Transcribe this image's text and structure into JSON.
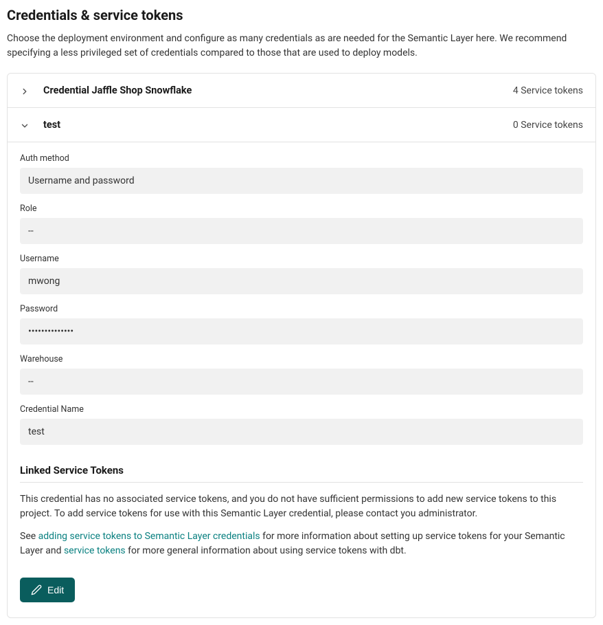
{
  "header": {
    "title": "Credentials & service tokens",
    "description": "Choose the deployment environment and configure as many credentials as are needed for the Semantic Layer here. We recommend specifying a less privileged set of credentials compared to those that are used to deploy models."
  },
  "credentials": [
    {
      "name": "Credential Jaffle Shop Snowflake",
      "token_count_label": "4 Service tokens",
      "expanded": false
    },
    {
      "name": "test",
      "token_count_label": "0 Service tokens",
      "expanded": true,
      "fields": {
        "auth_method": {
          "label": "Auth method",
          "value": "Username and password"
        },
        "role": {
          "label": "Role",
          "value": "--"
        },
        "username": {
          "label": "Username",
          "value": "mwong"
        },
        "password": {
          "label": "Password",
          "value": "••••••••••••••"
        },
        "warehouse": {
          "label": "Warehouse",
          "value": "--"
        },
        "credential_name": {
          "label": "Credential Name",
          "value": "test"
        }
      },
      "linked_tokens": {
        "heading": "Linked Service Tokens",
        "no_tokens_text": "This credential has no associated service tokens, and you do not have sufficient permissions to add new service tokens to this project. To add service tokens for use with this Semantic Layer credential, please contact you administrator.",
        "see_prefix": "See ",
        "link1": "adding service tokens to Semantic Layer credentials",
        "mid_text": " for more information about setting up service tokens for your Semantic Layer and ",
        "link2": "service tokens",
        "suffix_text": " for more general information about using service tokens with dbt."
      },
      "edit_label": "Edit"
    }
  ]
}
